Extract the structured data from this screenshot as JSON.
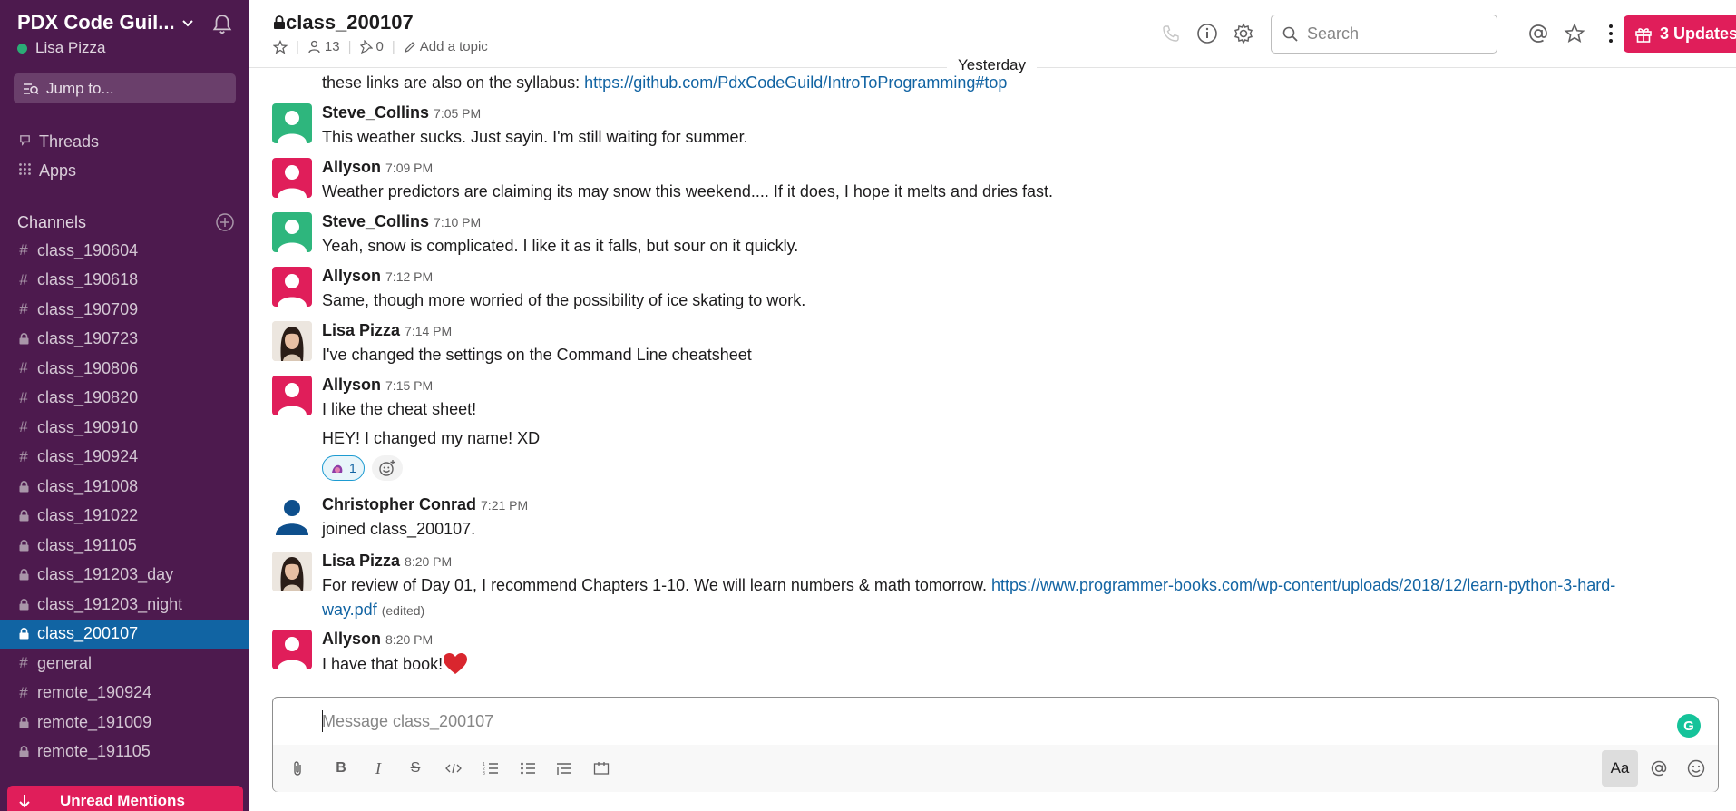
{
  "workspace": {
    "name": "PDX Code Guil...",
    "user": "Lisa Pizza"
  },
  "sidebar": {
    "jump_label": "Jump to...",
    "nav": [
      {
        "label": "Threads",
        "icon": "threads-icon"
      },
      {
        "label": "Apps",
        "icon": "apps-grid-icon"
      }
    ],
    "channels_header": "Channels",
    "channels": [
      {
        "label": "class_190604",
        "private": false,
        "active": false
      },
      {
        "label": "class_190618",
        "private": false,
        "active": false
      },
      {
        "label": "class_190709",
        "private": false,
        "active": false
      },
      {
        "label": "class_190723",
        "private": true,
        "active": false
      },
      {
        "label": "class_190806",
        "private": false,
        "active": false
      },
      {
        "label": "class_190820",
        "private": false,
        "active": false
      },
      {
        "label": "class_190910",
        "private": false,
        "active": false
      },
      {
        "label": "class_190924",
        "private": false,
        "active": false
      },
      {
        "label": "class_191008",
        "private": true,
        "active": false
      },
      {
        "label": "class_191022",
        "private": true,
        "active": false
      },
      {
        "label": "class_191105",
        "private": true,
        "active": false
      },
      {
        "label": "class_191203_day",
        "private": true,
        "active": false
      },
      {
        "label": "class_191203_night",
        "private": true,
        "active": false
      },
      {
        "label": "class_200107",
        "private": true,
        "active": true
      },
      {
        "label": "general",
        "private": false,
        "active": false
      },
      {
        "label": "remote_190924",
        "private": false,
        "active": false
      },
      {
        "label": "remote_191009",
        "private": true,
        "active": false
      },
      {
        "label": "remote_191105",
        "private": true,
        "active": false
      }
    ],
    "unread_label": "Unread Mentions"
  },
  "header": {
    "channel_name": "class_200107",
    "members": "13",
    "pins": "0",
    "add_topic": "Add a topic",
    "search_placeholder": "Search",
    "updates_label": "3 Updates"
  },
  "day_divider": "Yesterday",
  "messages": [
    {
      "text_prefix": "these links are also on the syllabus: ",
      "link": "https://github.com/PdxCodeGuild/IntroToProgramming#top"
    },
    {
      "author": "Steve_Collins",
      "time": "7:05 PM",
      "avatar": "green",
      "text": "This weather sucks. Just sayin.  I'm still waiting for summer."
    },
    {
      "author": "Allyson",
      "time": "7:09 PM",
      "avatar": "pink",
      "text": "Weather predictors are claiming its may snow this weekend....  If it does, I hope it melts and  dries fast."
    },
    {
      "author": "Steve_Collins",
      "time": "7:10 PM",
      "avatar": "green",
      "text": "Yeah, snow is complicated. I like it as it falls, but sour on it quickly."
    },
    {
      "author": "Allyson",
      "time": "7:12 PM",
      "avatar": "pink",
      "text": "Same, though more worried of the possibility of ice skating to work."
    },
    {
      "author": "Lisa Pizza",
      "time": "7:14 PM",
      "avatar": "photo",
      "text": "I've changed the settings on the Command Line cheatsheet"
    },
    {
      "author": "Allyson",
      "time": "7:15 PM",
      "avatar": "pink",
      "text": "I like the cheat sheet!",
      "text2": "HEY!  I changed my name! XD",
      "reaction_count": "1"
    },
    {
      "author": "Christopher Conrad",
      "time": "7:21 PM",
      "avatar": "blue",
      "text": "joined class_200107."
    },
    {
      "author": "Lisa Pizza",
      "time": "8:20 PM",
      "avatar": "photo",
      "text": "For review of Day 01, I recommend Chapters 1-10. We will learn numbers & math tomorrow. ",
      "link_part1": "https://www.programmer-books.com/wp-content/uploads/2018/12/learn-python-3-hard-",
      "link_part2": "way.pdf",
      "edited": "(edited)"
    },
    {
      "author": "Allyson",
      "time": "8:20 PM",
      "avatar": "pink",
      "text": "I have that book! "
    }
  ],
  "composer": {
    "placeholder": "Message class_200107",
    "format_label": "Aa"
  },
  "colors": {
    "sidebar": "#4d1a4e",
    "active": "#1164a3",
    "brand_red": "#e01e5a",
    "link": "#1264a3"
  }
}
